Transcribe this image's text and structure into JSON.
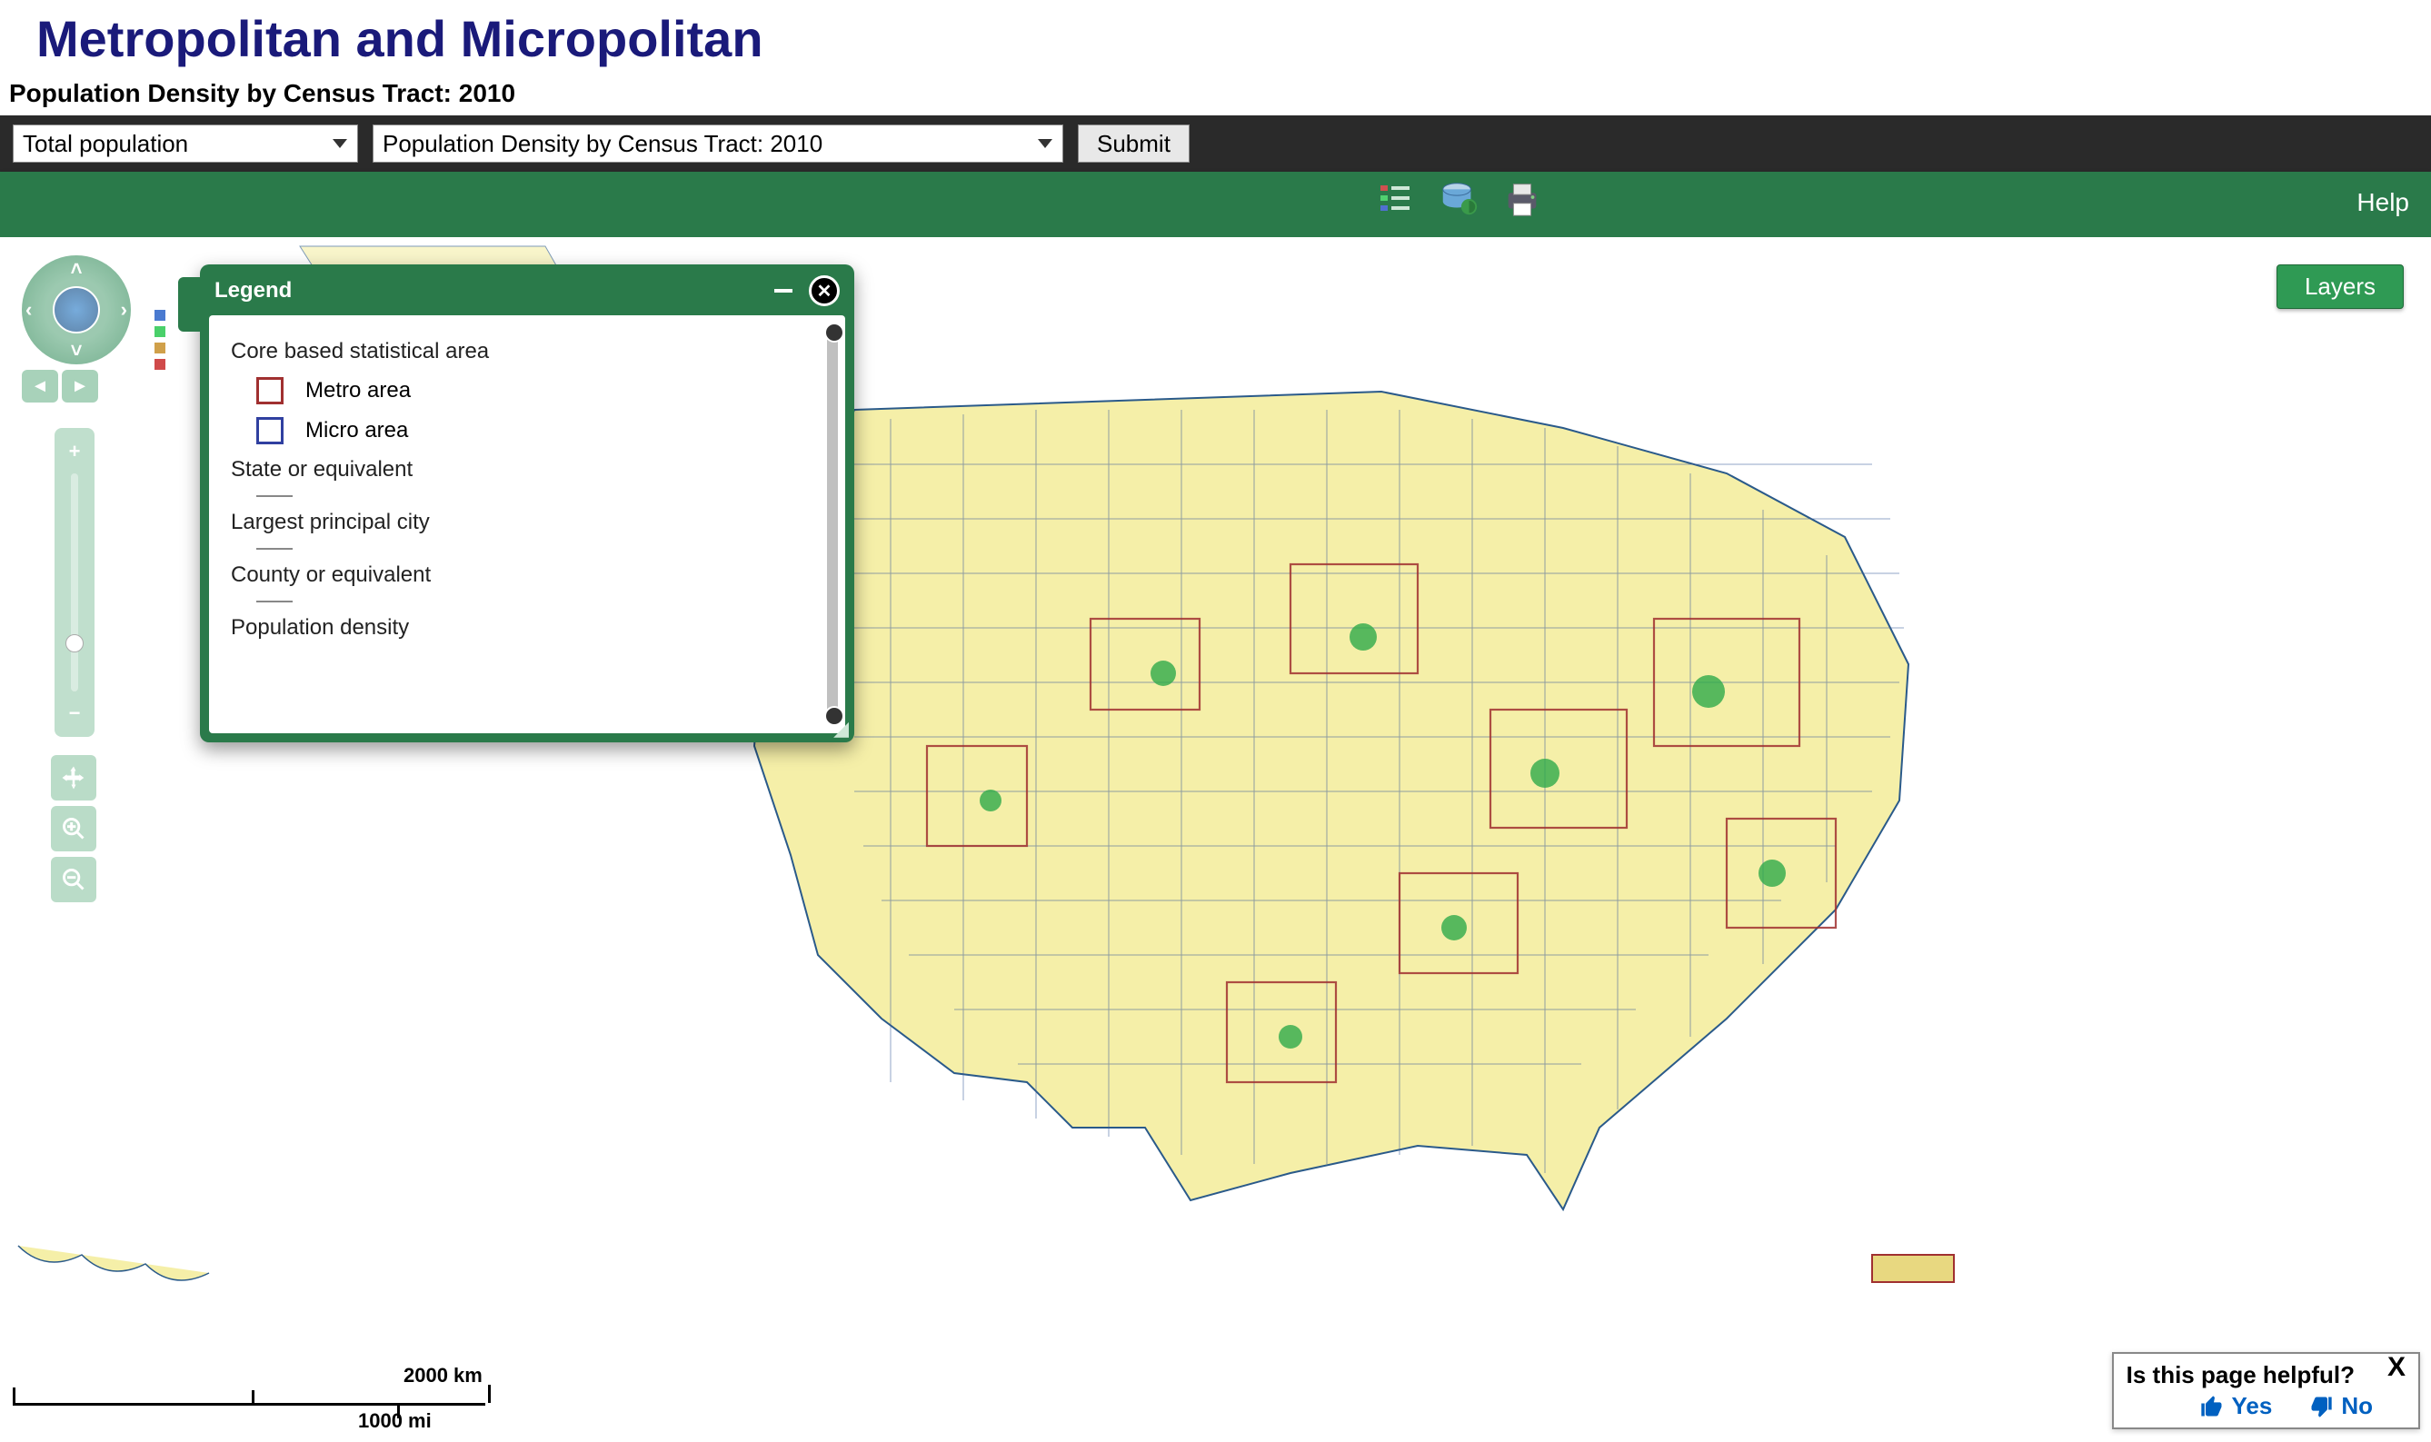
{
  "page_title": "Metropolitan and Micropolitan",
  "subtitle": "Population Density by Census Tract: 2010",
  "dark_bar": {
    "select1": {
      "selected": "Total population"
    },
    "select2": {
      "selected": "Population Density by Census Tract: 2010"
    },
    "submit_label": "Submit"
  },
  "green_bar": {
    "help_label": "Help",
    "icons": [
      "legend-toggle-icon",
      "data-layers-icon",
      "print-icon"
    ]
  },
  "layers_button": "Layers",
  "legend": {
    "title": "Legend",
    "sections": {
      "cbsa_header": "Core based statistical area",
      "metro": "Metro area",
      "micro": "Micro area",
      "state": "State or equivalent",
      "city": "Largest principal city",
      "county": "County or equivalent",
      "density": "Population density"
    }
  },
  "scalebar": {
    "top_label": "2000 km",
    "bottom_label": "1000 mi"
  },
  "feedback": {
    "question": "Is this page helpful?",
    "yes": "Yes",
    "no": "No",
    "close": "X"
  },
  "colors": {
    "brand_green": "#2a7a4a",
    "metro_outline": "#a03030",
    "micro_outline": "#3040a0",
    "land": "#f5efa8",
    "water": "#9fb8d8"
  }
}
